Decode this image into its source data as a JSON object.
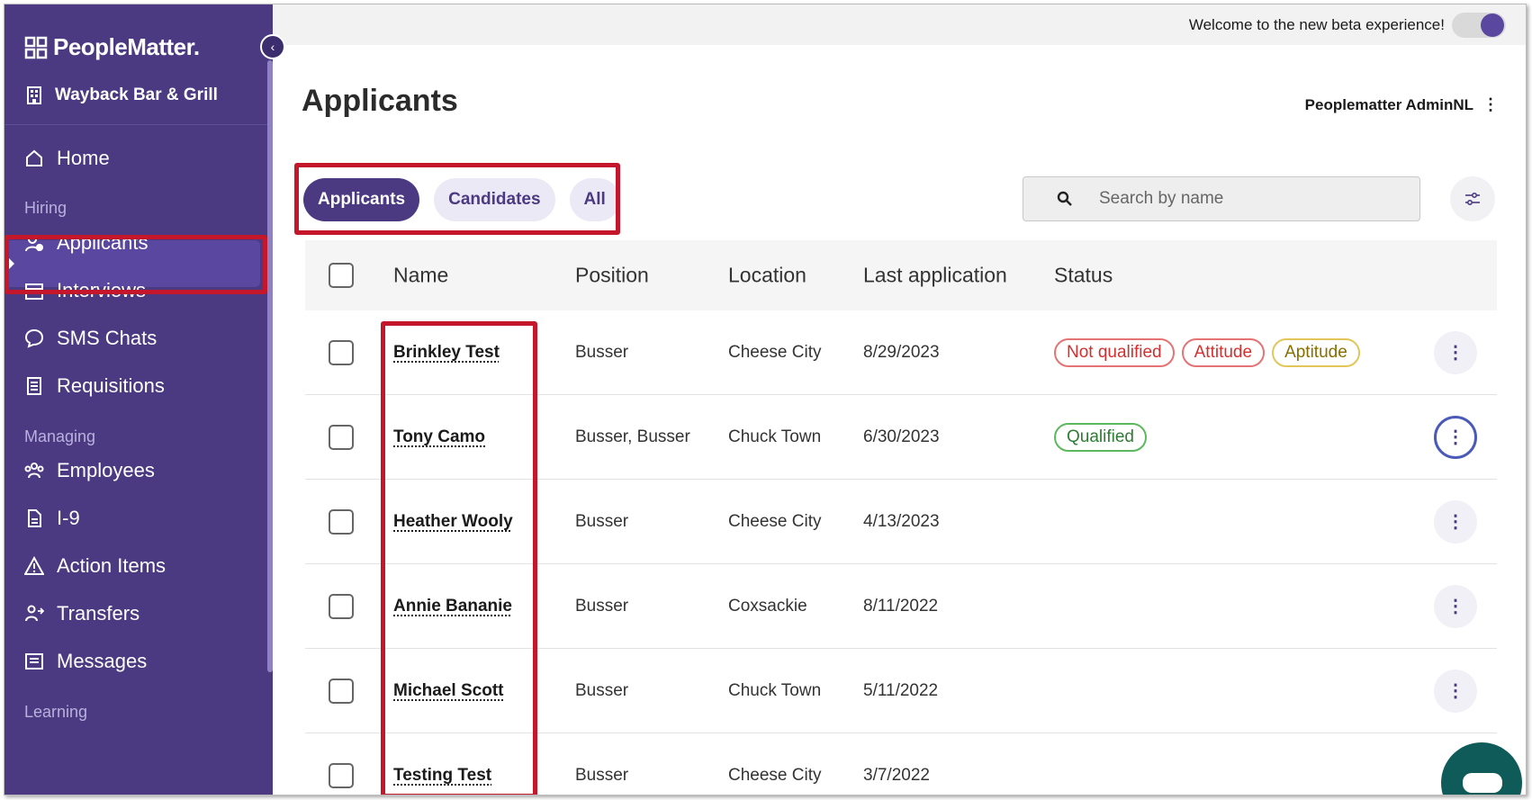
{
  "sidebar": {
    "logo": "PeopleMatter.",
    "location": "Wayback Bar & Grill",
    "items": [
      {
        "label": "Home",
        "icon": "home-icon"
      },
      {
        "section": "Hiring"
      },
      {
        "label": "Applicants",
        "icon": "applicants-icon",
        "active": true
      },
      {
        "label": "Interviews",
        "icon": "calendar-icon"
      },
      {
        "label": "SMS Chats",
        "icon": "chat-icon"
      },
      {
        "label": "Requisitions",
        "icon": "document-icon"
      },
      {
        "section": "Managing"
      },
      {
        "label": "Employees",
        "icon": "employees-icon"
      },
      {
        "label": "I-9",
        "icon": "file-icon"
      },
      {
        "label": "Action Items",
        "icon": "warning-icon"
      },
      {
        "label": "Transfers",
        "icon": "transfers-icon"
      },
      {
        "label": "Messages",
        "icon": "messages-icon"
      },
      {
        "section": "Learning"
      }
    ]
  },
  "topbar": {
    "beta_text": "Welcome to the new beta experience!",
    "toggle_on": true
  },
  "header": {
    "title": "Applicants",
    "user": "Peoplematter AdminNL"
  },
  "tabs": [
    {
      "label": "Applicants",
      "active": true
    },
    {
      "label": "Candidates",
      "active": false
    },
    {
      "label": "All",
      "active": false
    }
  ],
  "search": {
    "placeholder": "Search by name"
  },
  "table": {
    "columns": [
      "Name",
      "Position",
      "Location",
      "Last application",
      "Status"
    ],
    "rows": [
      {
        "name": "Brinkley Test",
        "position": "Busser",
        "location": "Cheese City",
        "last": "8/29/2023",
        "status": [
          {
            "label": "Not qualified",
            "color": "red"
          },
          {
            "label": "Attitude",
            "color": "red"
          },
          {
            "label": "Aptitude",
            "color": "yellow"
          }
        ]
      },
      {
        "name": "Tony Camo",
        "position": "Busser, Busser",
        "location": "Chuck Town",
        "last": "6/30/2023",
        "status": [
          {
            "label": "Qualified",
            "color": "green"
          }
        ],
        "menu_focused": true
      },
      {
        "name": "Heather Wooly",
        "position": "Busser",
        "location": "Cheese City",
        "last": "4/13/2023",
        "status": []
      },
      {
        "name": "Annie Bananie",
        "position": "Busser",
        "location": "Coxsackie",
        "last": "8/11/2022",
        "status": []
      },
      {
        "name": "Michael Scott",
        "position": "Busser",
        "location": "Chuck Town",
        "last": "5/11/2022",
        "status": []
      },
      {
        "name": "Testing Test",
        "position": "Busser",
        "location": "Cheese City",
        "last": "3/7/2022",
        "status": []
      }
    ]
  },
  "colors": {
    "brand": "#4b3a82",
    "highlight": "#c4172c"
  }
}
